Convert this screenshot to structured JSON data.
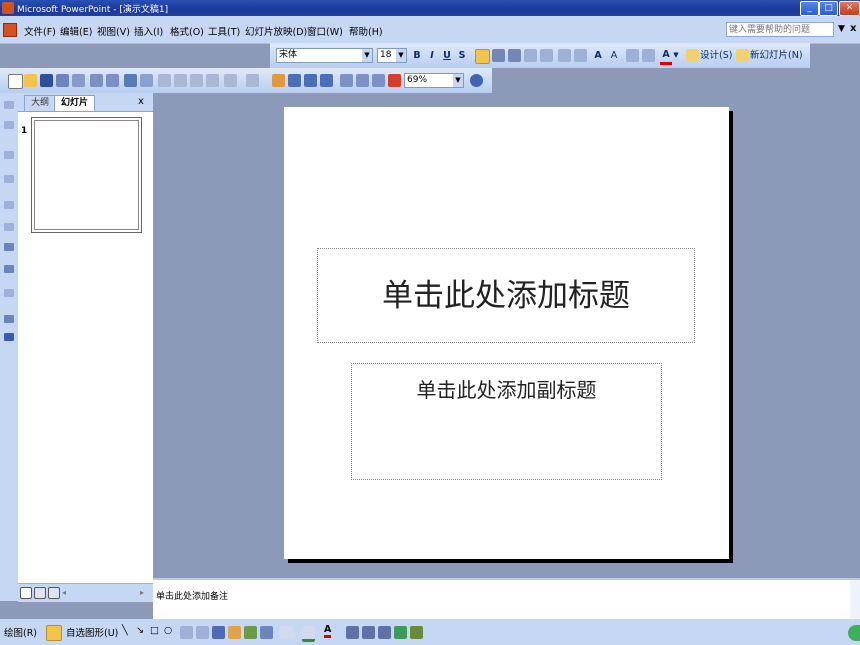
{
  "window": {
    "title": "Microsoft PowerPoint - [演示文稿1]"
  },
  "menu": {
    "items": [
      "文件(F)",
      "编辑(E)",
      "视图(V)",
      "插入(I)",
      "格式(O)",
      "工具(T)",
      "幻灯片放映(D)",
      "窗口(W)",
      "帮助(H)"
    ],
    "help_placeholder": "键入需要帮助的问题"
  },
  "format_toolbar": {
    "font": "宋体",
    "size": "18",
    "bold": "B",
    "italic": "I",
    "underline": "U",
    "shadow": "S",
    "design_label": "设计(S)",
    "new_slide_label": "新幻灯片(N)"
  },
  "standard_toolbar": {
    "zoom": "69%"
  },
  "left_panel": {
    "tabs": [
      "大纲",
      "幻灯片"
    ],
    "close": "x",
    "slide_number": "1"
  },
  "slide": {
    "title_placeholder": "单击此处添加标题",
    "subtitle_placeholder": "单击此处添加副标题"
  },
  "notes": {
    "placeholder": "单击此处添加备注"
  },
  "drawing_toolbar": {
    "draw_label": "绘图(R)",
    "autoshapes_label": "自选图形(U)"
  },
  "colors": {
    "accent": "#2a4fb5",
    "toolbar": "#c5d7f3",
    "canvas": "#8d99b8"
  }
}
